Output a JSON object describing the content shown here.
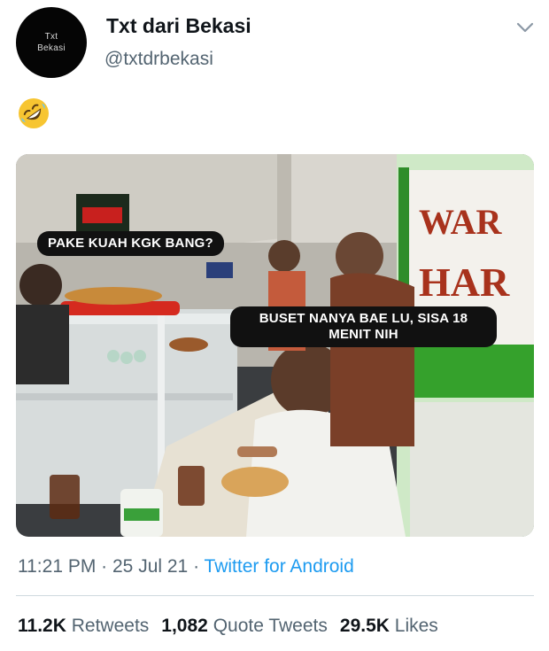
{
  "author": {
    "avatar_line1": "Txt",
    "avatar_line2": "Bekasi",
    "name": "Txt dari Bekasi",
    "handle": "@txtdrbekasi"
  },
  "tweet": {
    "emoji_icon": "rolling-on-the-floor-laughing-emoji"
  },
  "media": {
    "caption_top": "PAKE KUAH KGK BANG?",
    "caption_bottom": "BUSET NANYA BAE LU, SISA 18 MENIT NIH"
  },
  "meta": {
    "time": "11:21 PM",
    "sep1": " · ",
    "date": "25 Jul 21",
    "sep2": " · ",
    "source": "Twitter for Android"
  },
  "stats": {
    "retweets_count": "11.2K",
    "retweets_label": "Retweets",
    "quotes_count": "1,082",
    "quotes_label": "Quote Tweets",
    "likes_count": "29.5K",
    "likes_label": "Likes"
  },
  "colors": {
    "link_blue": "#1d9bf0",
    "secondary_text": "#536471"
  }
}
